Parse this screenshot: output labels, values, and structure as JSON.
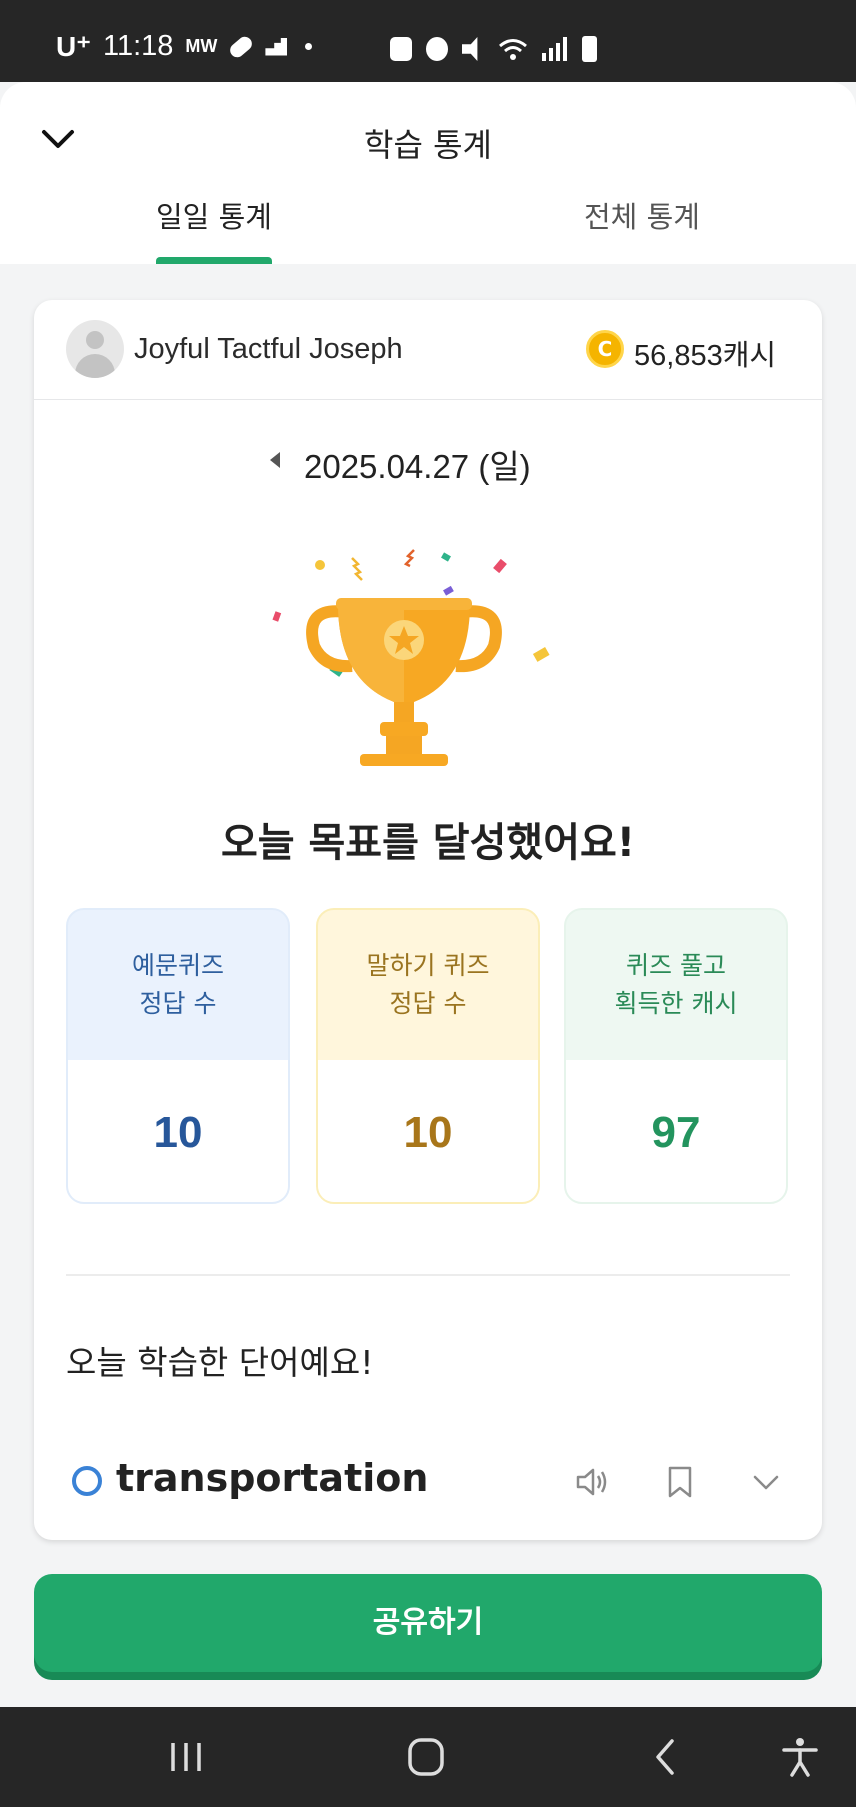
{
  "status_bar": {
    "carrier": "U⁺",
    "time": "11:18",
    "mw": "MW"
  },
  "header": {
    "title": "학습 통계"
  },
  "tabs": [
    {
      "label": "일일 통계"
    },
    {
      "label": "전체 통계"
    }
  ],
  "user": {
    "name": "Joyful Tactful Joseph",
    "cash": "56,853캐시",
    "coin_symbol": "C"
  },
  "date": "2025.04.27 (일)",
  "goal_message": "오늘 목표를 달성했어요!",
  "stats": [
    {
      "label_line1": "예문퀴즈",
      "label_line2": "정답 수",
      "value": "10"
    },
    {
      "label_line1": "말하기 퀴즈",
      "label_line2": "정답 수",
      "value": "10"
    },
    {
      "label_line1": "퀴즈 풀고",
      "label_line2": "획득한 캐시",
      "value": "97"
    }
  ],
  "learned": {
    "title": "오늘 학습한 단어예요!",
    "word": "transportation"
  },
  "share_button": "공유하기",
  "colors": {
    "accent": "#21a86b",
    "status_bar": "#262626"
  }
}
